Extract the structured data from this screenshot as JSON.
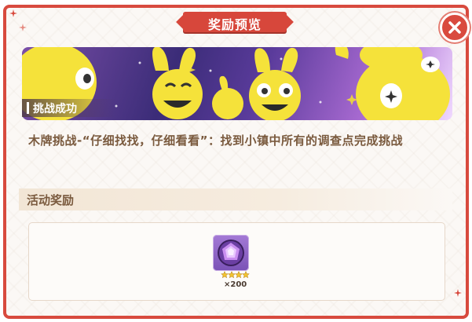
{
  "dialog": {
    "title": "奖励预览",
    "close_icon": "close-icon"
  },
  "banner": {
    "label": "挑战成功"
  },
  "description": "木牌挑战-“仔细找找，仔细看看”：找到小镇中所有的调查点完成挑战",
  "rewards_section": {
    "title": "活动奖励",
    "items": [
      {
        "icon": "purple-gem-orb-icon",
        "stars": 4,
        "quantity": "×200"
      }
    ]
  },
  "colors": {
    "accent_red": "#d7473b",
    "text_brown": "#7a5a3e"
  }
}
